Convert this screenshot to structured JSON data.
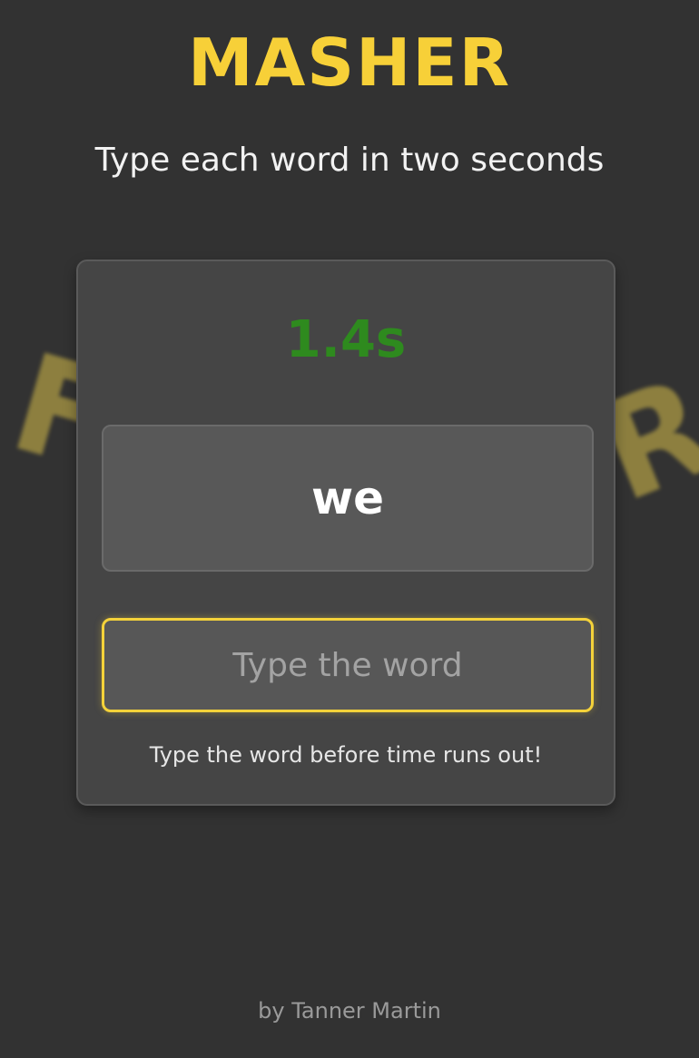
{
  "app": {
    "title": "MASHER",
    "subtitle": "Type each word in two seconds"
  },
  "background": {
    "left_glyph": "F",
    "right_glyph": "R"
  },
  "game": {
    "timer": "1.4s",
    "current_word": "we",
    "input_value": "",
    "input_placeholder": "Type the word",
    "hint": "Type the word before time runs out!"
  },
  "footer": {
    "credit": "by Tanner Martin"
  },
  "colors": {
    "background": "#323232",
    "accent": "#f7d038",
    "timer": "#2e8a1e",
    "card": "#454545"
  }
}
